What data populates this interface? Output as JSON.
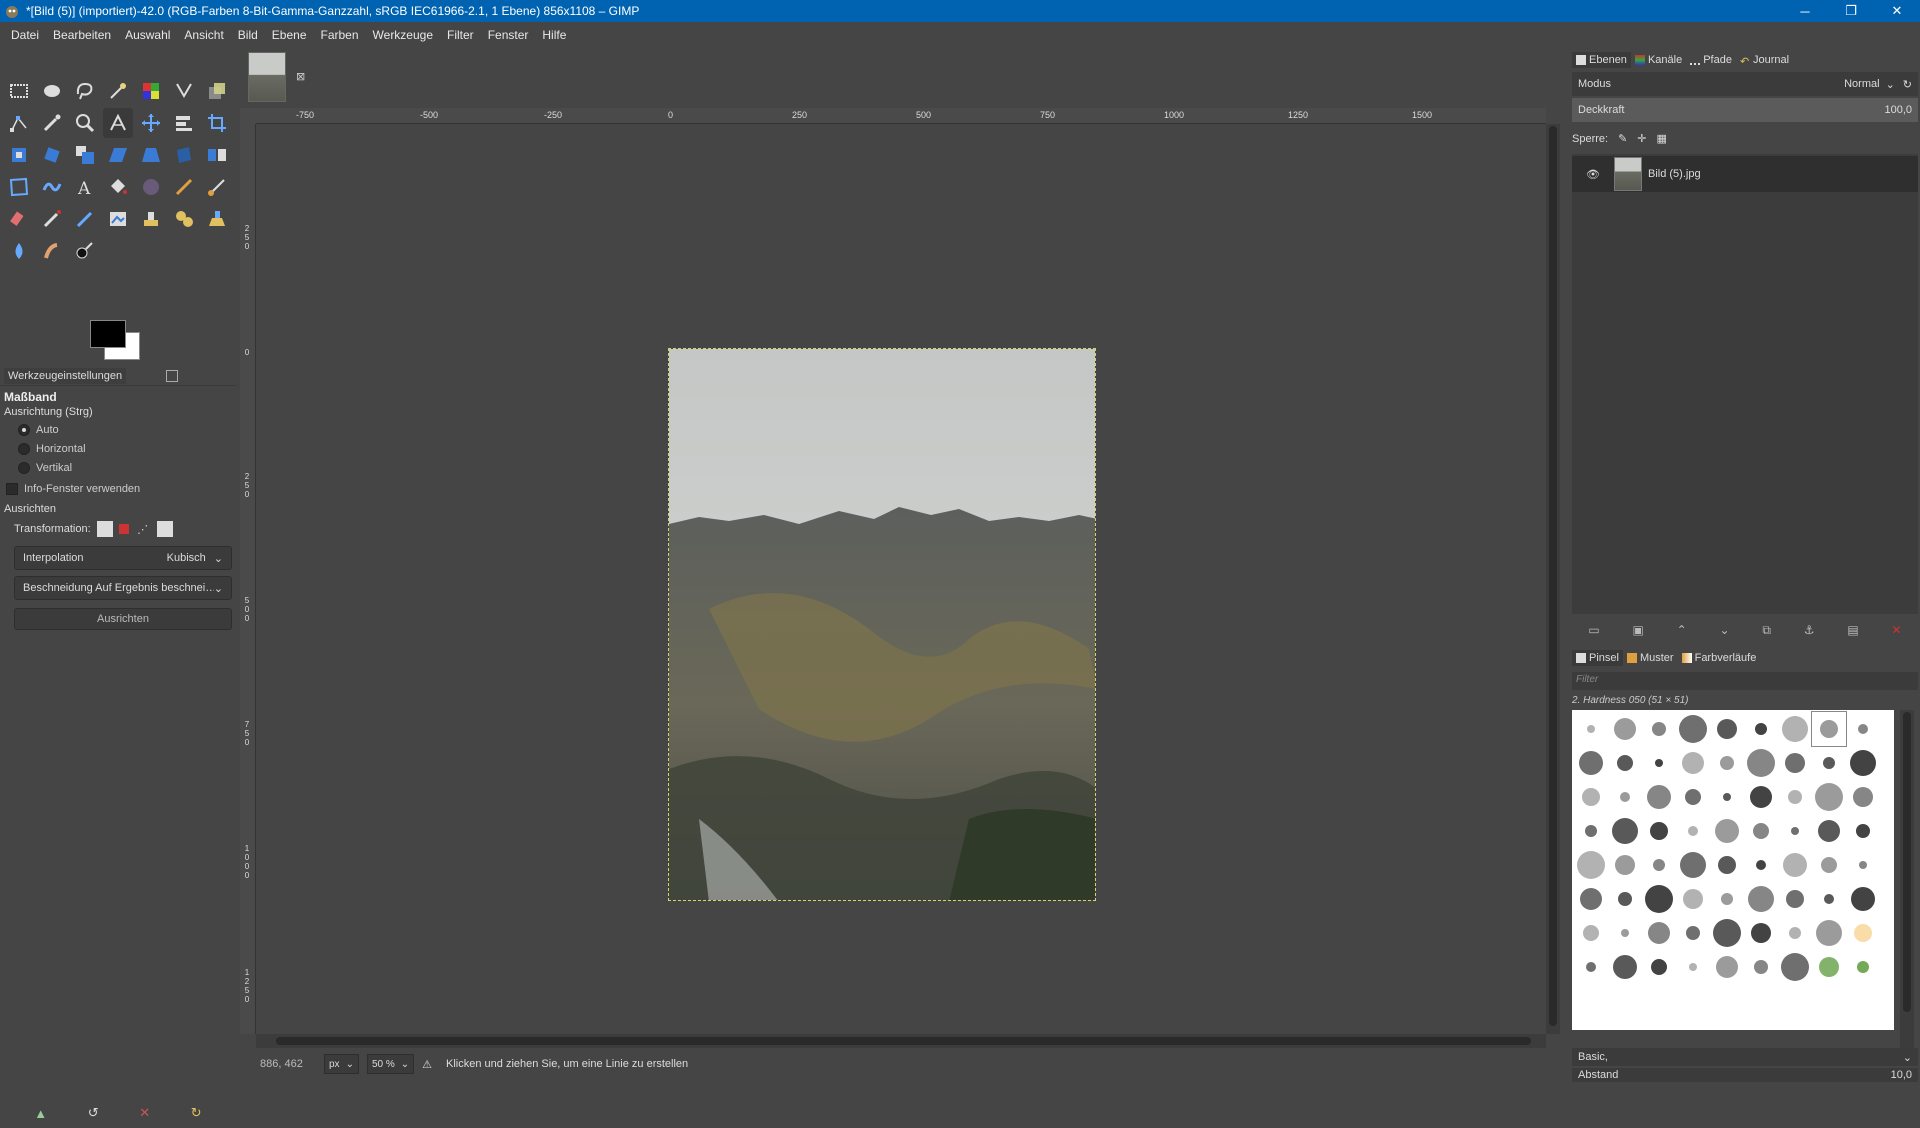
{
  "window": {
    "title": "*[Bild (5)] (importiert)-42.0 (RGB-Farben 8-Bit-Gamma-Ganzzahl, sRGB IEC61966-2.1, 1 Ebene) 856x1108 – GIMP",
    "minimize": "─",
    "maximize": "❐",
    "close": "✕"
  },
  "menu": [
    "Datei",
    "Bearbeiten",
    "Auswahl",
    "Ansicht",
    "Bild",
    "Ebene",
    "Farben",
    "Werkzeuge",
    "Filter",
    "Fenster",
    "Hilfe"
  ],
  "tool_options": {
    "tab": "Werkzeugeinstellungen",
    "tool_name": "Maßband",
    "orientation_label": "Ausrichtung (Strg)",
    "orientation_options": [
      "Auto",
      "Horizontal",
      "Vertikal"
    ],
    "selected_orientation": "Auto",
    "info_window": "Info-Fenster verwenden",
    "align_label": "Ausrichten",
    "transform_label": "Transformation:",
    "interpolation_label": "Interpolation",
    "interpolation_value": "Kubisch",
    "clipping_value": "Beschneidung Auf Ergebnis beschnei…",
    "align_button": "Ausrichten"
  },
  "rulers": {
    "horizontal": [
      "-750",
      "-500",
      "-250",
      "0",
      "250",
      "500",
      "750",
      "1000",
      "1250",
      "1500"
    ],
    "vertical": [
      "250",
      "0",
      "250",
      "500",
      "750",
      "1000",
      "1250"
    ]
  },
  "image_tab": {
    "close": "⊠"
  },
  "status": {
    "coords": "886, 462",
    "unit": "px",
    "zoom": "50 %",
    "message": "Klicken und ziehen Sie, um eine Linie zu erstellen"
  },
  "layers_dock": {
    "tabs": [
      "Ebenen",
      "Kanäle",
      "Pfade",
      "Journal"
    ],
    "mode_label": "Modus",
    "mode_value": "Normal",
    "opacity_label": "Deckkraft",
    "opacity_value": "100,0",
    "lock_label": "Sperre:",
    "layers": [
      {
        "name": "Bild (5).jpg",
        "visible": true
      }
    ]
  },
  "brushes_dock": {
    "tabs": [
      "Pinsel",
      "Muster",
      "Farbverläufe"
    ],
    "filter_placeholder": "Filter",
    "current_brush": "2. Hardness 050 (51 × 51)",
    "preset": "Basic,",
    "spacing_label": "Abstand",
    "spacing_value": "10,0"
  },
  "colors": {
    "foreground": "#000000",
    "background": "#ffffff",
    "titlebar": "#0063b1"
  }
}
